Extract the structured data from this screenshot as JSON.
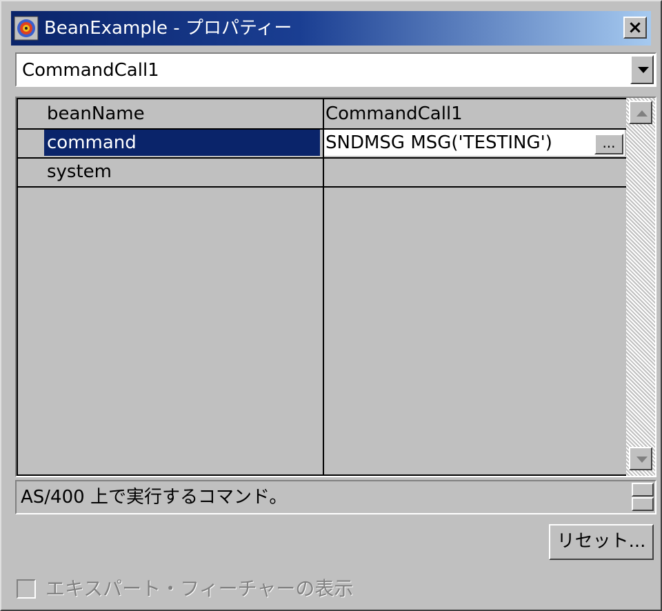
{
  "window": {
    "title": "BeanExample - プロパティー",
    "close_label": "×"
  },
  "bean_selector": {
    "selected": "CommandCall1"
  },
  "property_table": {
    "rows": [
      {
        "name": "beanName",
        "value": "CommandCall1",
        "selected": false
      },
      {
        "name": "command",
        "value": "SNDMSG MSG('TESTING')",
        "selected": true,
        "editor_button": "..."
      },
      {
        "name": "system",
        "value": "",
        "selected": false
      }
    ]
  },
  "description": {
    "text": "AS/400 上で実行するコマンド。"
  },
  "buttons": {
    "reset_label": "リセット..."
  },
  "expert": {
    "label": "エキスパート・フィーチャーの表示",
    "checked": false,
    "enabled": false
  },
  "colors": {
    "title_gradient_start": "#0a246a",
    "title_gradient_end": "#a6caf0",
    "selection": "#0a246a",
    "face": "#c0c0c0"
  }
}
